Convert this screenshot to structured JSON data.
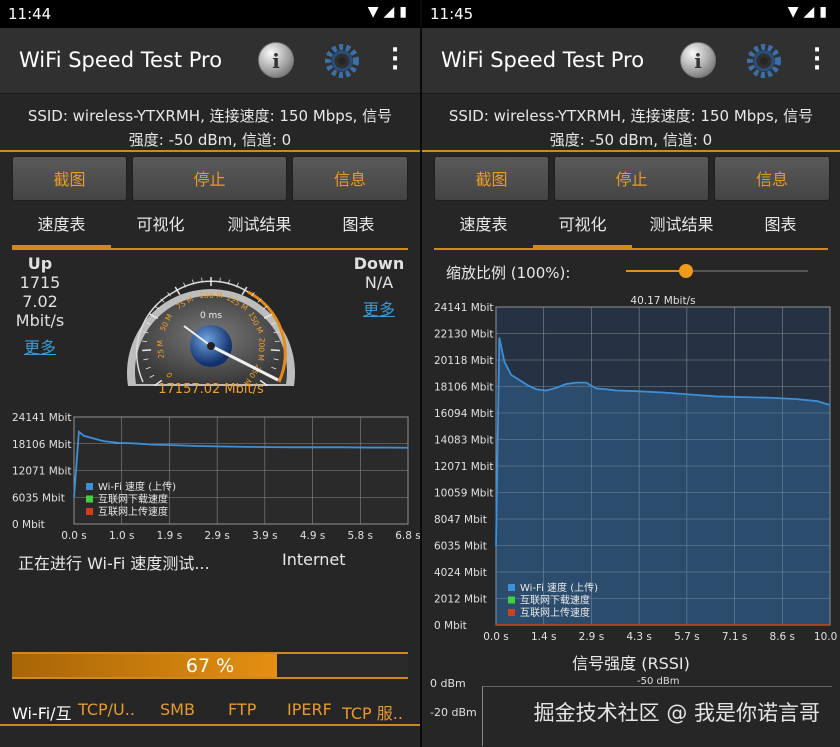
{
  "left": {
    "status_time": "11:44",
    "app_title": "WiFi Speed Test Pro",
    "ssid_line1": "SSID: wireless-YTXRMH, 连接速度: 150 Mbps, 信号",
    "ssid_line2": "强度: -50 dBm, 信道: 0",
    "buttons": [
      "截图",
      "停止",
      "信息"
    ],
    "tabs": [
      "速度表",
      "可视化",
      "测试结果",
      "图表"
    ],
    "selected_tab": 0,
    "up": {
      "label": "Up",
      "v1": "1715",
      "v2": "7.02",
      "unit": "Mbit/s",
      "more": "更多"
    },
    "down": {
      "label": "Down",
      "value": "N/A",
      "more": "更多"
    },
    "gauge": {
      "scale_labels": [
        "0",
        "25 M",
        "50 M",
        "75 M",
        "100 M",
        "125 M",
        "150 M",
        "200 M",
        "250 M"
      ],
      "latency": "0 ms",
      "reading": "17157.02 Mbit/s"
    },
    "status_text": "正在进行 Wi-Fi 速度测试...",
    "target": "Internet",
    "progress": {
      "label": "67 %",
      "fraction": 0.67
    },
    "bottom_tabs": [
      "Wi-Fi/互",
      "TCP/U..",
      "SMB",
      "FTP",
      "IPERF",
      "TCP 服.."
    ]
  },
  "right": {
    "status_time": "11:45",
    "app_title": "WiFi Speed Test Pro",
    "ssid_line1": "SSID: wireless-YTXRMH, 连接速度: 150 Mbps, 信号",
    "ssid_line2": "强度: -50 dBm, 信道: 0",
    "buttons": [
      "截图",
      "停止",
      "信息"
    ],
    "tabs": [
      "速度表",
      "可视化",
      "测试结果",
      "图表"
    ],
    "selected_tab": 1,
    "zoom_label": "缩放比例 (100%):",
    "zoom_value": 0.33,
    "rssi_title": "信号强度 (RSSI)",
    "rssi_ticks": [
      "0 dBm",
      "-20 dBm"
    ],
    "rssi_value_label": "-50 dBm",
    "watermark": "掘金技术社区 @ 我是你诺言哥"
  },
  "colors": {
    "accent": "#d08a1c",
    "series_up": "#3d8fd6",
    "series_down": "#3fd13f",
    "series_upload": "#d0401f"
  },
  "chart_data": [
    {
      "type": "line",
      "yticks": [
        "24141 Mbit",
        "18106 Mbit",
        "12071 Mbit",
        "6035 Mbit",
        "0 Mbit"
      ],
      "ylim": [
        0,
        24141
      ],
      "xticks": [
        "0.0 s",
        "1.0 s",
        "1.9 s",
        "2.9 s",
        "3.9 s",
        "4.9 s",
        "5.8 s",
        "6.8 s"
      ],
      "xlim": [
        0,
        6.8
      ],
      "legend": [
        "Wi-Fi 速度 (上传)",
        "互联网下载速度",
        "互联网上传速度"
      ],
      "legend_position": "bottom-left",
      "grid": true,
      "series": [
        {
          "name": "Wi-Fi 速度 (上传)",
          "x": [
            0.0,
            0.1,
            0.2,
            0.4,
            0.6,
            0.9,
            1.2,
            1.6,
            2.0,
            2.5,
            3.0,
            3.5,
            4.0,
            4.5,
            5.0,
            5.5,
            6.0,
            6.4,
            6.8
          ],
          "y": [
            6000,
            20800,
            19900,
            19300,
            18700,
            18300,
            18200,
            17900,
            17800,
            17600,
            17500,
            17400,
            17350,
            17300,
            17300,
            17300,
            17250,
            17250,
            17200
          ]
        }
      ]
    },
    {
      "type": "line",
      "title": "40.17 Mbit/s",
      "yticks": [
        "24141 Mbit",
        "22130 Mbit",
        "20118 Mbit",
        "18106 Mbit",
        "16094 Mbit",
        "14083 Mbit",
        "12071 Mbit",
        "10059 Mbit",
        "8047 Mbit",
        "6035 Mbit",
        "4024 Mbit",
        "2012 Mbit",
        "0 Mbit"
      ],
      "ylim": [
        0,
        24141
      ],
      "xticks": [
        "0.0 s",
        "1.4 s",
        "2.9 s",
        "4.3 s",
        "5.7 s",
        "7.1 s",
        "8.6 s",
        "10.0 s"
      ],
      "xlim": [
        0,
        10.0
      ],
      "legend": [
        "Wi-Fi 速度 (上传)",
        "互联网下载速度",
        "互联网上传速度"
      ],
      "legend_position": "bottom-left",
      "grid": true,
      "series": [
        {
          "name": "Wi-Fi 速度 (上传)",
          "x": [
            0.0,
            0.1,
            0.25,
            0.45,
            0.7,
            0.95,
            1.2,
            1.5,
            1.8,
            2.1,
            2.4,
            2.7,
            3.0,
            3.3,
            3.6,
            4.2,
            5.0,
            5.8,
            6.6,
            7.4,
            8.2,
            9.0,
            9.6,
            10.0
          ],
          "y": [
            6000,
            21800,
            20000,
            19000,
            18600,
            18200,
            17900,
            17800,
            18000,
            18300,
            18400,
            18400,
            17950,
            17900,
            17800,
            17750,
            17650,
            17500,
            17350,
            17300,
            17250,
            17150,
            17000,
            16700
          ]
        }
      ]
    }
  ]
}
